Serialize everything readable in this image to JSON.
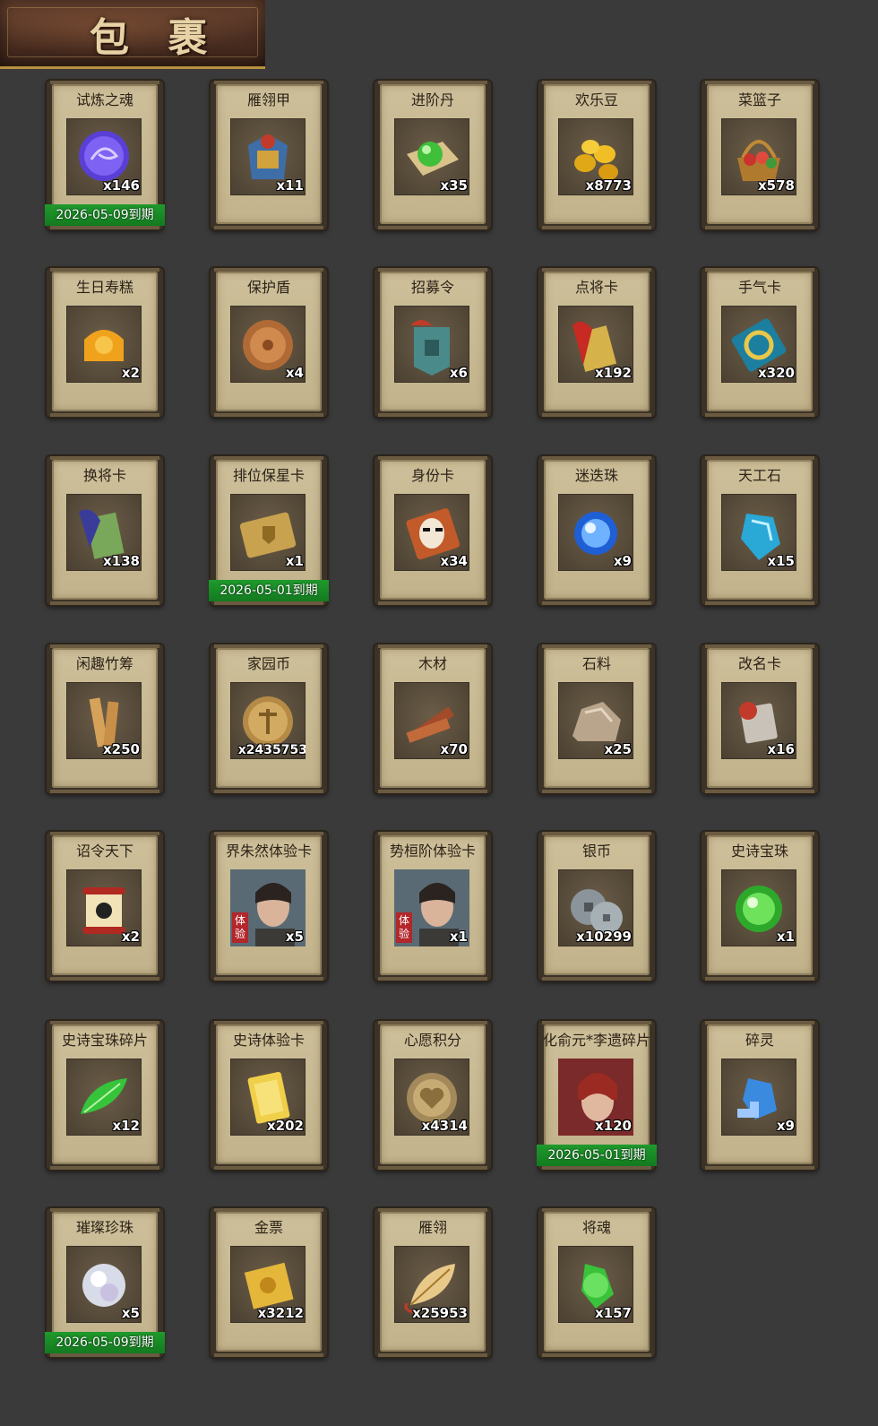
{
  "header": {
    "title": "包 裹"
  },
  "items": [
    {
      "name": "试炼之魂",
      "count": "x146",
      "expiry": "2026-05-09到期",
      "icon": "purple-dragon-orb-icon"
    },
    {
      "name": "雁翎甲",
      "count": "x11",
      "icon": "armor-icon"
    },
    {
      "name": "进阶丹",
      "count": "x35",
      "icon": "green-pill-scroll-icon"
    },
    {
      "name": "欢乐豆",
      "count": "x8773",
      "icon": "golden-beans-icon"
    },
    {
      "name": "菜篮子",
      "count": "x578",
      "icon": "basket-icon"
    },
    {
      "name": "生日寿糕",
      "count": "x2",
      "icon": "birthday-cake-icon"
    },
    {
      "name": "保护盾",
      "count": "x4",
      "icon": "shield-icon"
    },
    {
      "name": "招募令",
      "count": "x6",
      "icon": "recruit-token-icon"
    },
    {
      "name": "点将卡",
      "count": "x192",
      "icon": "general-card-icon"
    },
    {
      "name": "手气卡",
      "count": "x320",
      "icon": "luck-card-icon"
    },
    {
      "name": "换将卡",
      "count": "x138",
      "icon": "swap-general-card-icon"
    },
    {
      "name": "排位保星卡",
      "count": "x1",
      "expiry": "2026-05-01到期",
      "icon": "rank-star-card-icon"
    },
    {
      "name": "身份卡",
      "count": "x34",
      "icon": "opera-mask-card-icon"
    },
    {
      "name": "迷迭珠",
      "count": "x9",
      "icon": "blue-orb-icon"
    },
    {
      "name": "天工石",
      "count": "x15",
      "icon": "blue-crystal-icon"
    },
    {
      "name": "闲趣竹筹",
      "count": "x250",
      "icon": "bamboo-tally-icon"
    },
    {
      "name": "家园币",
      "count": "x2435753",
      "wide": true,
      "icon": "home-coin-icon"
    },
    {
      "name": "木材",
      "count": "x70",
      "icon": "wood-icon"
    },
    {
      "name": "石料",
      "count": "x25",
      "icon": "stone-icon"
    },
    {
      "name": "改名卡",
      "count": "x16",
      "icon": "rename-card-icon"
    },
    {
      "name": "诏令天下",
      "count": "x2",
      "icon": "edict-scroll-icon"
    },
    {
      "name": "界朱然体验卡",
      "count": "x5",
      "trial": "体验",
      "icon": "hero-portrait-icon"
    },
    {
      "name": "势桓阶体验卡",
      "count": "x1",
      "trial": "体验",
      "icon": "hero-portrait-icon"
    },
    {
      "name": "银币",
      "count": "x10299",
      "icon": "silver-coins-icon"
    },
    {
      "name": "史诗宝珠",
      "count": "x1",
      "icon": "green-orb-icon"
    },
    {
      "name": "史诗宝珠碎片",
      "count": "x12",
      "icon": "green-leaf-shard-icon"
    },
    {
      "name": "史诗体验卡",
      "count": "x202",
      "icon": "gold-card-icon"
    },
    {
      "name": "心愿积分",
      "count": "x4314",
      "icon": "heart-coin-icon"
    },
    {
      "name": "化俞元*李遗碎片",
      "count": "x120",
      "expiry": "2026-05-01到期",
      "icon": "hero-fragment-portrait-icon"
    },
    {
      "name": "碎灵",
      "count": "x9",
      "icon": "crystal-puzzle-icon"
    },
    {
      "name": "璀璨珍珠",
      "count": "x5",
      "expiry": "2026-05-09到期",
      "icon": "pearl-icon"
    },
    {
      "name": "金票",
      "count": "x3212",
      "icon": "gold-ticket-icon"
    },
    {
      "name": "雁翎",
      "count": "x25953",
      "icon": "feather-icon"
    },
    {
      "name": "将魂",
      "count": "x157",
      "icon": "green-soul-crystal-icon"
    }
  ]
}
